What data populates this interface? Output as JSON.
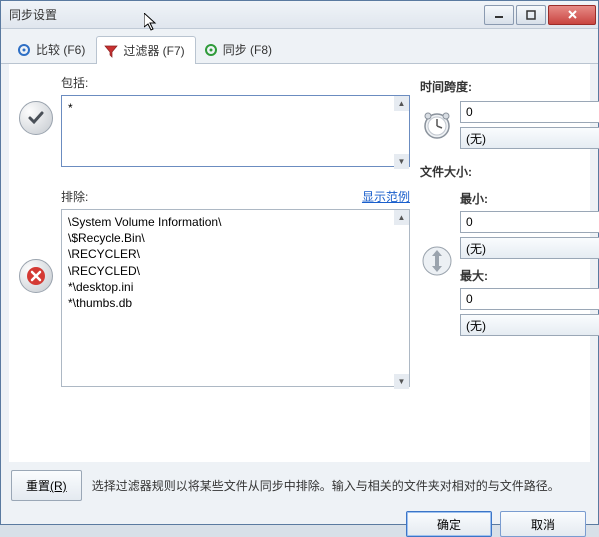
{
  "window": {
    "title": "同步设置"
  },
  "tabs": [
    {
      "label": "比较 (F6)",
      "icon": "gear-icon"
    },
    {
      "label": "过滤器 (F7)",
      "icon": "funnel-icon",
      "active": true
    },
    {
      "label": "同步 (F8)",
      "icon": "sync-gear-icon"
    }
  ],
  "include": {
    "label": "包括:",
    "value": "*"
  },
  "exclude": {
    "label": "排除:",
    "example_link": "显示范例",
    "value": "\\System Volume Information\\\n\\$Recycle.Bin\\\n\\RECYCLER\\\n\\RECYCLED\\\n*\\desktop.ini\n*\\thumbs.db"
  },
  "timespan": {
    "title": "时间跨度:",
    "value": "0",
    "unit": "(无)"
  },
  "filesize": {
    "title": "文件大小:",
    "min_label": "最小:",
    "min_value": "0",
    "min_unit": "(无)",
    "max_label": "最大:",
    "max_value": "0",
    "max_unit": "(无)"
  },
  "reset": {
    "label": "重置",
    "key": "(R)"
  },
  "hint": "选择过滤器规则以将某些文件从同步中排除。输入与相关的文件夹对相对的与文件路径。",
  "buttons": {
    "ok": "确定",
    "cancel": "取消"
  }
}
